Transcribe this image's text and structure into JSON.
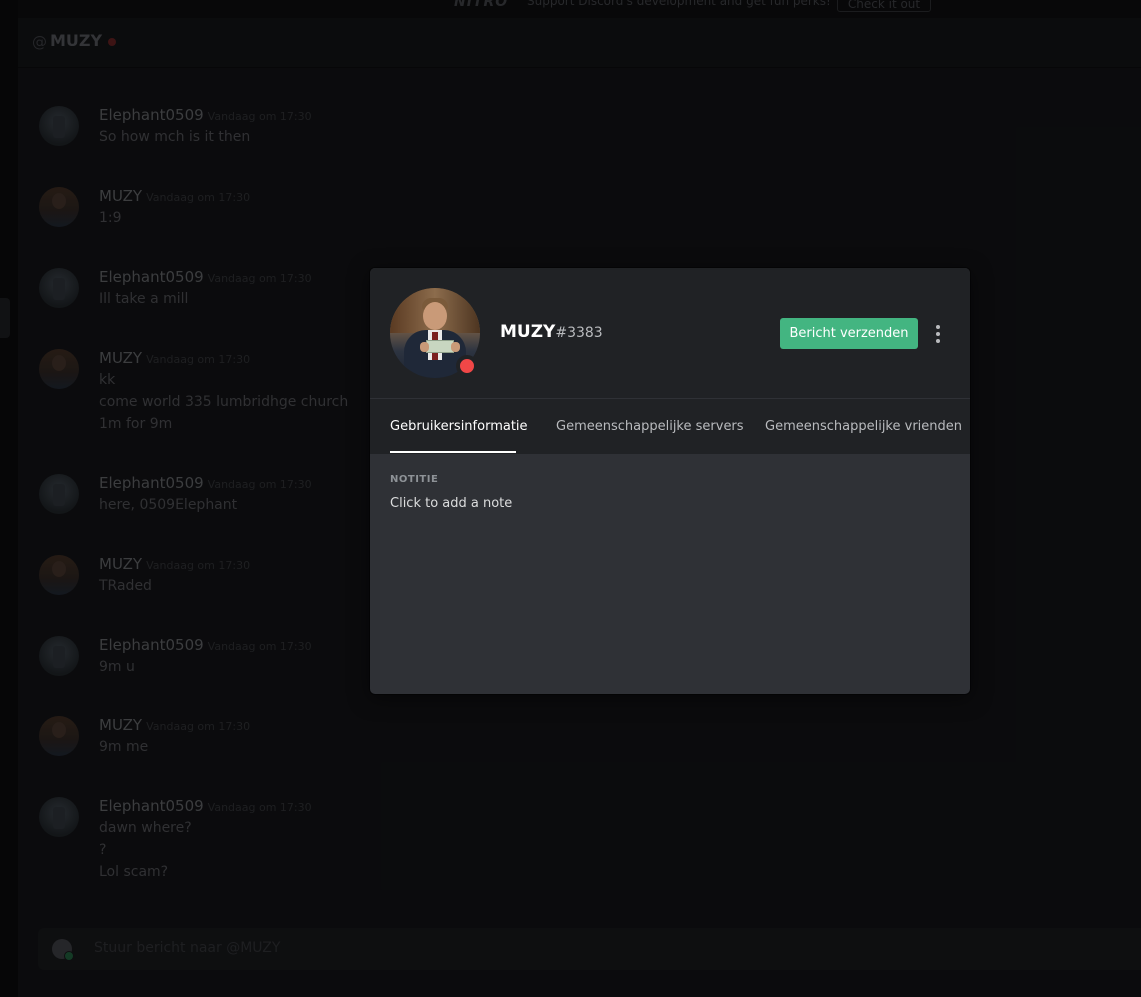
{
  "nitro_bar": {
    "logo": "NITRO",
    "text": "Support Discord's development and get fun perks!",
    "button": "Check it out"
  },
  "header": {
    "at_symbol": "@",
    "channel_name": "MUZY",
    "status_color": "#f04747"
  },
  "messages": [
    {
      "author": "Elephant0509",
      "timestamp": "Vandaag om 17:30",
      "lines": [
        "So how mch is it then"
      ]
    },
    {
      "author": "MUZY",
      "timestamp": "Vandaag om 17:30",
      "lines": [
        "1:9"
      ]
    },
    {
      "author": "Elephant0509",
      "timestamp": "Vandaag om 17:30",
      "lines": [
        "Ill take a mill"
      ]
    },
    {
      "author": "MUZY",
      "timestamp": "Vandaag om 17:30",
      "lines": [
        "kk",
        "come world 335 lumbridhge church",
        "1m for 9m"
      ]
    },
    {
      "author": "Elephant0509",
      "timestamp": "Vandaag om 17:30",
      "lines": [
        "here, 0509Elephant"
      ]
    },
    {
      "author": "MUZY",
      "timestamp": "Vandaag om 17:30",
      "lines": [
        "TRaded"
      ]
    },
    {
      "author": "Elephant0509",
      "timestamp": "Vandaag om 17:30",
      "lines": [
        "9m u"
      ]
    },
    {
      "author": "MUZY",
      "timestamp": "Vandaag om 17:30",
      "lines": [
        "9m me"
      ]
    },
    {
      "author": "Elephant0509",
      "timestamp": "Vandaag om 17:30",
      "lines": [
        "dawn where?",
        "?",
        "Lol scam?"
      ]
    }
  ],
  "composer": {
    "placeholder": "Stuur bericht naar @MUZY"
  },
  "profile": {
    "username": "MUZY",
    "discriminator": "#3383",
    "status": "dnd",
    "status_color": "#f04747",
    "send_button": "Bericht verzenden",
    "more_icon": "more-vertical-icon",
    "tabs": [
      {
        "label": "Gebruikersinformatie",
        "active": true
      },
      {
        "label": "Gemeenschappelijke servers",
        "active": false
      },
      {
        "label": "Gemeenschappelijke vrienden",
        "active": false
      }
    ],
    "note_title": "NOTITIE",
    "note_placeholder": "Click to add a note",
    "accent_color": "#43b581"
  }
}
